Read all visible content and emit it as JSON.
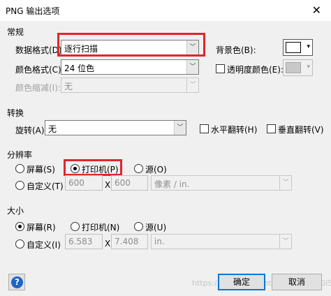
{
  "window": {
    "title": "PNG 输出选项",
    "close_glyph": "✕"
  },
  "general": {
    "heading": "常规",
    "data_format_label": "数据格式(D):",
    "data_format_value": "逐行扫描",
    "bg_color_label": "背景色(B):",
    "color_format_label": "颜色格式(C):",
    "color_format_value": "24 位色",
    "transparent_label": "透明度颜色(E):",
    "color_reduce_label": "颜色缩减(I):",
    "color_reduce_value": "无"
  },
  "transform": {
    "heading": "转换",
    "rotate_label": "旋转(A):",
    "rotate_value": "无",
    "flip_h_label": "水平翻转(H)",
    "flip_v_label": "垂直翻转(V)"
  },
  "resolution": {
    "heading": "分辨率",
    "screen_label": "屏幕(S)",
    "printer_label": "打印机(P)",
    "source_label": "源(O)",
    "custom_label": "自定义(T)",
    "width": "600",
    "height": "600",
    "times": "X",
    "unit": "像素 / in.",
    "selected": "printer"
  },
  "size": {
    "heading": "大小",
    "screen_label": "屏幕(R)",
    "printer_label": "打印机(N)",
    "source_label": "源(U)",
    "custom_label": "自定义(I)",
    "width": "6.583",
    "height": "7.408",
    "times": "X",
    "unit": "in.",
    "selected": "screen"
  },
  "buttons": {
    "ok": "确定",
    "cancel": "取消",
    "help_glyph": "?"
  },
  "watermark": "https://blog.csdn.net/...  @ 碳排放 GIS",
  "colors": {
    "highlight_box": "#e0262a",
    "dialog_bg": "#f0f0f0",
    "default_button_border": "#0078d7",
    "help_blue": "#1e64c8"
  }
}
